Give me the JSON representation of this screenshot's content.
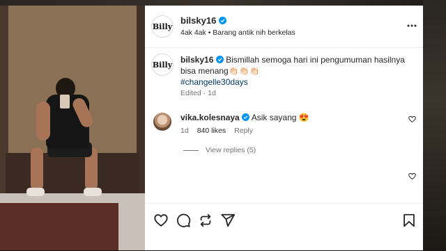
{
  "post": {
    "username": "bilsky16",
    "avatar_text": "Billy",
    "subtitle": "4ak 4ak • Barang antik nih berkelas"
  },
  "caption": {
    "username": "bilsky16",
    "text": "Bismillah semoga hari ini pengumuman hasilnya bisa menang",
    "emoji": "👏🏻👏🏻👏🏻",
    "hashtag": "#changelle30days",
    "meta": "Edited · 1d"
  },
  "comment": {
    "username": "vika.kolesnaya",
    "text": "Asik sayang",
    "emoji": "😍",
    "age": "1d",
    "likes": "840 likes",
    "reply_label": "Reply"
  },
  "replies": {
    "label": "View replies (5)"
  },
  "colors": {
    "verified": "#0095f6",
    "hashtag": "#00376b",
    "muted": "#737373"
  },
  "icons": [
    "verified-icon",
    "more-icon",
    "heart-icon",
    "comment-icon",
    "repost-icon",
    "share-icon",
    "bookmark-icon"
  ]
}
